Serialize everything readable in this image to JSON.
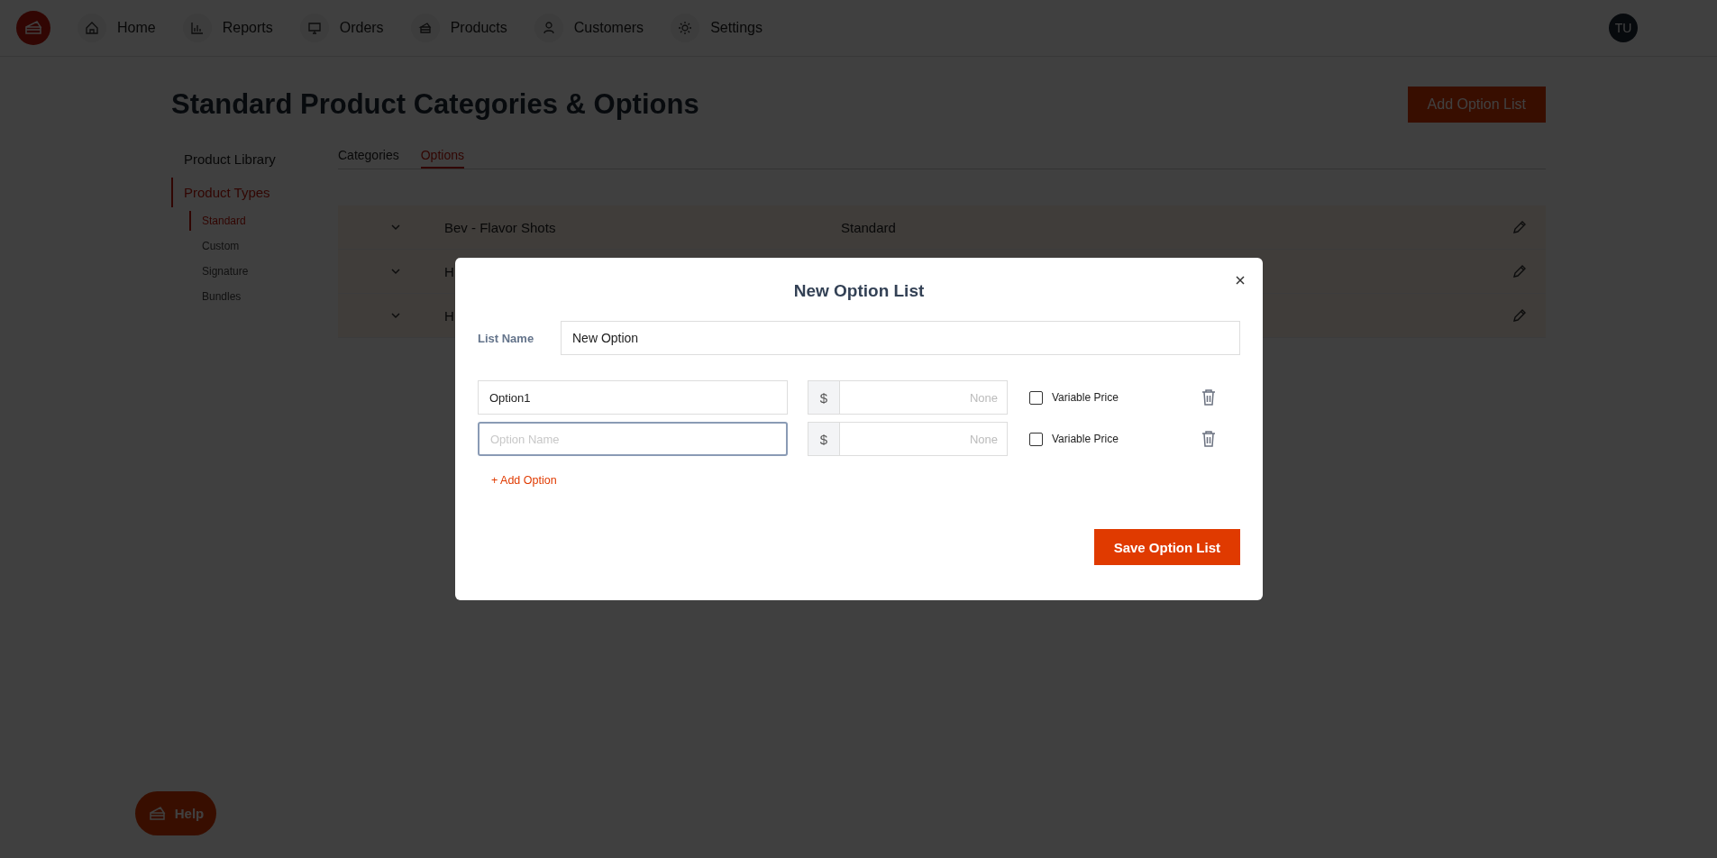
{
  "nav": {
    "items": [
      {
        "label": "Home",
        "kind": "home"
      },
      {
        "label": "Reports",
        "kind": "chart"
      },
      {
        "label": "Orders",
        "kind": "monitor"
      },
      {
        "label": "Products",
        "kind": "cake"
      },
      {
        "label": "Customers",
        "kind": "person"
      },
      {
        "label": "Settings",
        "kind": "gear"
      }
    ],
    "avatar": "TU"
  },
  "page": {
    "title": "Standard Product Categories & Options",
    "add_button": "Add Option List"
  },
  "sidebar": {
    "items": [
      {
        "label": "Product Library",
        "selected": false
      },
      {
        "label": "Product Types",
        "selected": true,
        "children": [
          {
            "label": "Standard",
            "selected": true
          },
          {
            "label": "Custom",
            "selected": false
          },
          {
            "label": "Signature",
            "selected": false
          },
          {
            "label": "Bundles",
            "selected": false
          }
        ]
      }
    ]
  },
  "tabs": [
    {
      "label": "Categories",
      "selected": false
    },
    {
      "label": "Options",
      "selected": true
    }
  ],
  "table": {
    "rows": [
      {
        "name": "Bev - Flavor Shots",
        "type": "Standard"
      },
      {
        "name": "H"
      },
      {
        "name": "H"
      }
    ]
  },
  "modal": {
    "title": "New Option List",
    "list_name_label": "List Name",
    "list_name": "New Option",
    "options": [
      {
        "value": "Option1",
        "focused": false,
        "currency": "$",
        "price_placeholder": "None",
        "variable_price": false,
        "variable_label": "Variable Price"
      },
      {
        "placeholder": "Option Name",
        "focused": true,
        "currency": "$",
        "price_placeholder": "None",
        "variable_price": false,
        "variable_label": "Variable Price"
      }
    ],
    "add_option": "+ Add Option",
    "save_button": "Save Option List"
  },
  "help": {
    "label": "Help"
  }
}
